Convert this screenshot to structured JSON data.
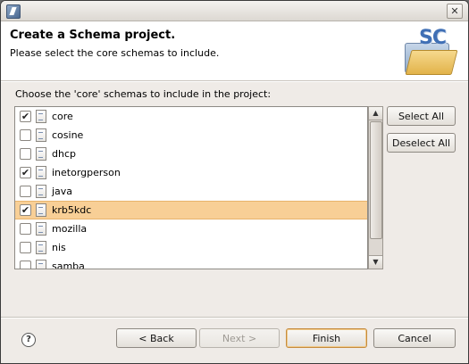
{
  "window": {
    "close_glyph": "✕"
  },
  "header": {
    "title": "Create a Schema project.",
    "description": "Please select the core schemas to include.",
    "banner_text": "SC"
  },
  "prompt": "Choose the 'core' schemas to include in the project:",
  "schemas": [
    {
      "name": "core",
      "checked": true,
      "selected": false
    },
    {
      "name": "cosine",
      "checked": false,
      "selected": false
    },
    {
      "name": "dhcp",
      "checked": false,
      "selected": false
    },
    {
      "name": "inetorgperson",
      "checked": true,
      "selected": false
    },
    {
      "name": "java",
      "checked": false,
      "selected": false
    },
    {
      "name": "krb5kdc",
      "checked": true,
      "selected": true
    },
    {
      "name": "mozilla",
      "checked": false,
      "selected": false
    },
    {
      "name": "nis",
      "checked": false,
      "selected": false
    },
    {
      "name": "samba",
      "checked": false,
      "selected": false
    }
  ],
  "side_buttons": {
    "select_all": "Select All",
    "deselect_all": "Deselect All"
  },
  "footer": {
    "help_glyph": "?",
    "back": "< Back",
    "next": "Next >",
    "finish": "Finish",
    "cancel": "Cancel"
  },
  "colors": {
    "selection": "#f8cf96",
    "banner": "#3f6fb5"
  }
}
